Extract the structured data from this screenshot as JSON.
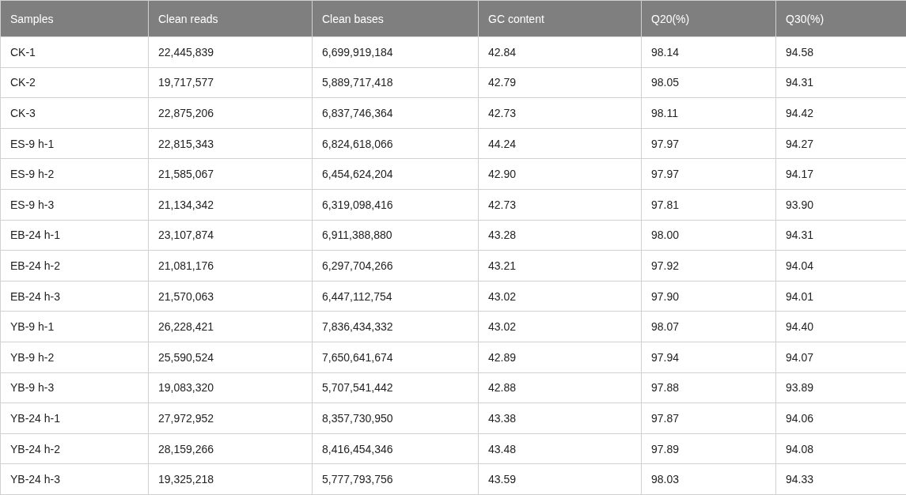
{
  "table": {
    "columns": [
      "Samples",
      "Clean reads",
      "Clean bases",
      "GC content",
      "Q20(%)",
      "Q30(%)"
    ],
    "rows": [
      [
        "CK-1",
        "22,445,839",
        "6,699,919,184",
        "42.84",
        "98.14",
        "94.58"
      ],
      [
        "CK-2",
        "19,717,577",
        "5,889,717,418",
        "42.79",
        "98.05",
        "94.31"
      ],
      [
        "CK-3",
        "22,875,206",
        "6,837,746,364",
        "42.73",
        "98.11",
        "94.42"
      ],
      [
        "ES-9 h-1",
        "22,815,343",
        "6,824,618,066",
        "44.24",
        "97.97",
        "94.27"
      ],
      [
        "ES-9 h-2",
        "21,585,067",
        "6,454,624,204",
        "42.90",
        "97.97",
        "94.17"
      ],
      [
        "ES-9 h-3",
        "21,134,342",
        "6,319,098,416",
        "42.73",
        "97.81",
        "93.90"
      ],
      [
        "EB-24 h-1",
        "23,107,874",
        "6,911,388,880",
        "43.28",
        "98.00",
        "94.31"
      ],
      [
        "EB-24 h-2",
        "21,081,176",
        "6,297,704,266",
        "43.21",
        "97.92",
        "94.04"
      ],
      [
        "EB-24 h-3",
        "21,570,063",
        "6,447,112,754",
        "43.02",
        "97.90",
        "94.01"
      ],
      [
        "YB-9 h-1",
        "26,228,421",
        "7,836,434,332",
        "43.02",
        "98.07",
        "94.40"
      ],
      [
        "YB-9 h-2",
        "25,590,524",
        "7,650,641,674",
        "42.89",
        "97.94",
        "94.07"
      ],
      [
        "YB-9 h-3",
        "19,083,320",
        "5,707,541,442",
        "42.88",
        "97.88",
        "93.89"
      ],
      [
        "YB-24 h-1",
        "27,972,952",
        "8,357,730,950",
        "43.38",
        "97.87",
        "94.06"
      ],
      [
        "YB-24 h-2",
        "28,159,266",
        "8,416,454,346",
        "43.48",
        "97.89",
        "94.08"
      ],
      [
        "YB-24 h-3",
        "19,325,218",
        "5,777,793,756",
        "43.59",
        "98.03",
        "94.33"
      ]
    ]
  }
}
